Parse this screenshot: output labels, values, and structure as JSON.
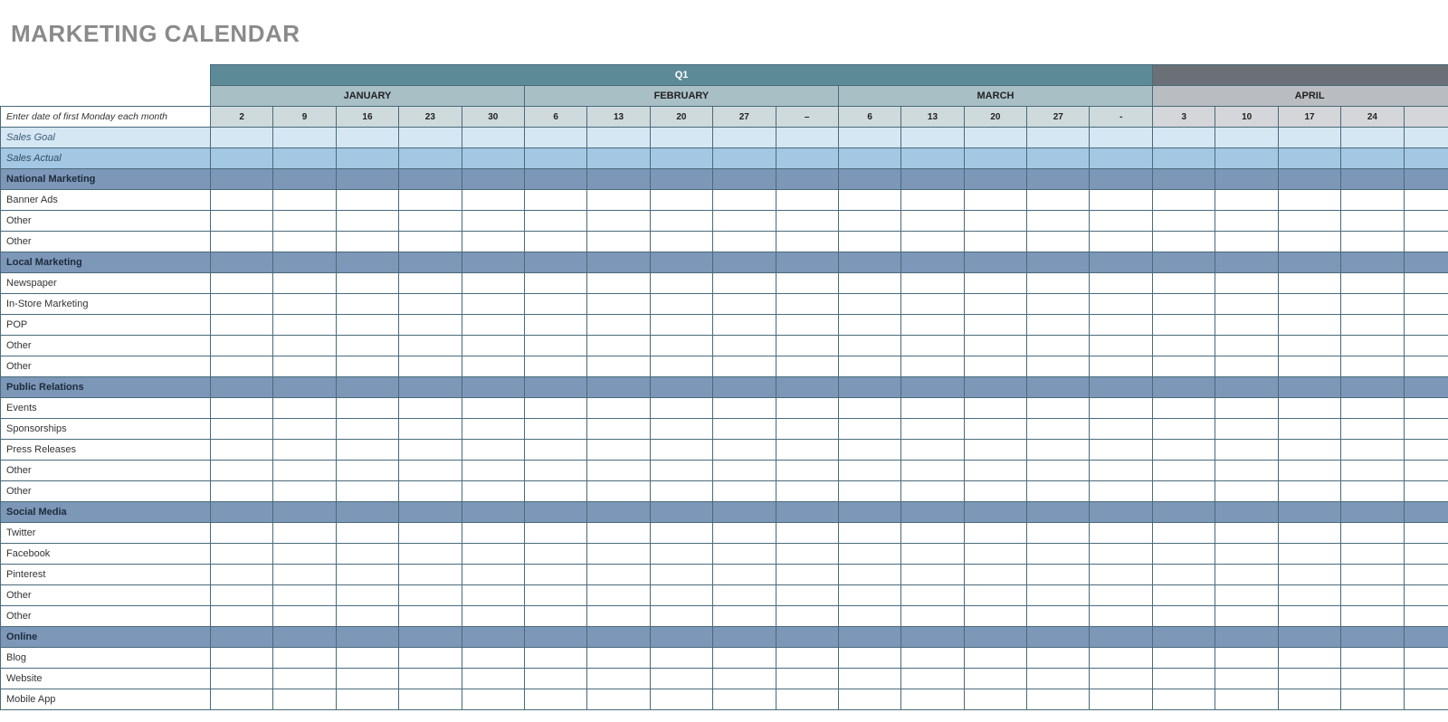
{
  "title": "MARKETING CALENDAR",
  "quarters": [
    {
      "label": "Q1",
      "span": 15
    },
    {
      "label": "",
      "span": 5
    }
  ],
  "months": [
    {
      "label": "JANUARY",
      "span": 5,
      "q": 1
    },
    {
      "label": "FEBRUARY",
      "span": 5,
      "q": 1
    },
    {
      "label": "MARCH",
      "span": 5,
      "q": 1
    },
    {
      "label": "APRIL",
      "span": 5,
      "q": 2
    }
  ],
  "weeks": [
    {
      "v": "2",
      "q": 1
    },
    {
      "v": "9",
      "q": 1
    },
    {
      "v": "16",
      "q": 1
    },
    {
      "v": "23",
      "q": 1
    },
    {
      "v": "30",
      "q": 1
    },
    {
      "v": "6",
      "q": 1
    },
    {
      "v": "13",
      "q": 1
    },
    {
      "v": "20",
      "q": 1
    },
    {
      "v": "27",
      "q": 1
    },
    {
      "v": "–",
      "q": 1
    },
    {
      "v": "6",
      "q": 1
    },
    {
      "v": "13",
      "q": 1
    },
    {
      "v": "20",
      "q": 1
    },
    {
      "v": "27",
      "q": 1
    },
    {
      "v": "-",
      "q": 1
    },
    {
      "v": "3",
      "q": 2
    },
    {
      "v": "10",
      "q": 2
    },
    {
      "v": "17",
      "q": 2
    },
    {
      "v": "24",
      "q": 2
    },
    {
      "v": "",
      "q": 2
    }
  ],
  "rows": [
    {
      "label": "Enter date of first Monday each month",
      "type": "instr"
    },
    {
      "label": "Sales Goal",
      "type": "sales-goal"
    },
    {
      "label": "Sales Actual",
      "type": "sales-actual"
    },
    {
      "label": "National Marketing",
      "type": "section"
    },
    {
      "label": "Banner Ads",
      "type": "plain"
    },
    {
      "label": "Other",
      "type": "plain"
    },
    {
      "label": "Other",
      "type": "plain"
    },
    {
      "label": "Local Marketing",
      "type": "section"
    },
    {
      "label": "Newspaper",
      "type": "plain"
    },
    {
      "label": "In-Store Marketing",
      "type": "plain"
    },
    {
      "label": "POP",
      "type": "plain"
    },
    {
      "label": "Other",
      "type": "plain"
    },
    {
      "label": "Other",
      "type": "plain"
    },
    {
      "label": "Public Relations",
      "type": "section"
    },
    {
      "label": "Events",
      "type": "plain"
    },
    {
      "label": "Sponsorships",
      "type": "plain"
    },
    {
      "label": "Press Releases",
      "type": "plain"
    },
    {
      "label": "Other",
      "type": "plain"
    },
    {
      "label": "Other",
      "type": "plain"
    },
    {
      "label": "Social Media",
      "type": "section"
    },
    {
      "label": "Twitter",
      "type": "plain"
    },
    {
      "label": "Facebook",
      "type": "plain"
    },
    {
      "label": "Pinterest",
      "type": "plain"
    },
    {
      "label": "Other",
      "type": "plain"
    },
    {
      "label": "Other",
      "type": "plain"
    },
    {
      "label": "Online",
      "type": "section"
    },
    {
      "label": "Blog",
      "type": "plain"
    },
    {
      "label": "Website",
      "type": "plain"
    },
    {
      "label": "Mobile App",
      "type": "plain"
    }
  ]
}
